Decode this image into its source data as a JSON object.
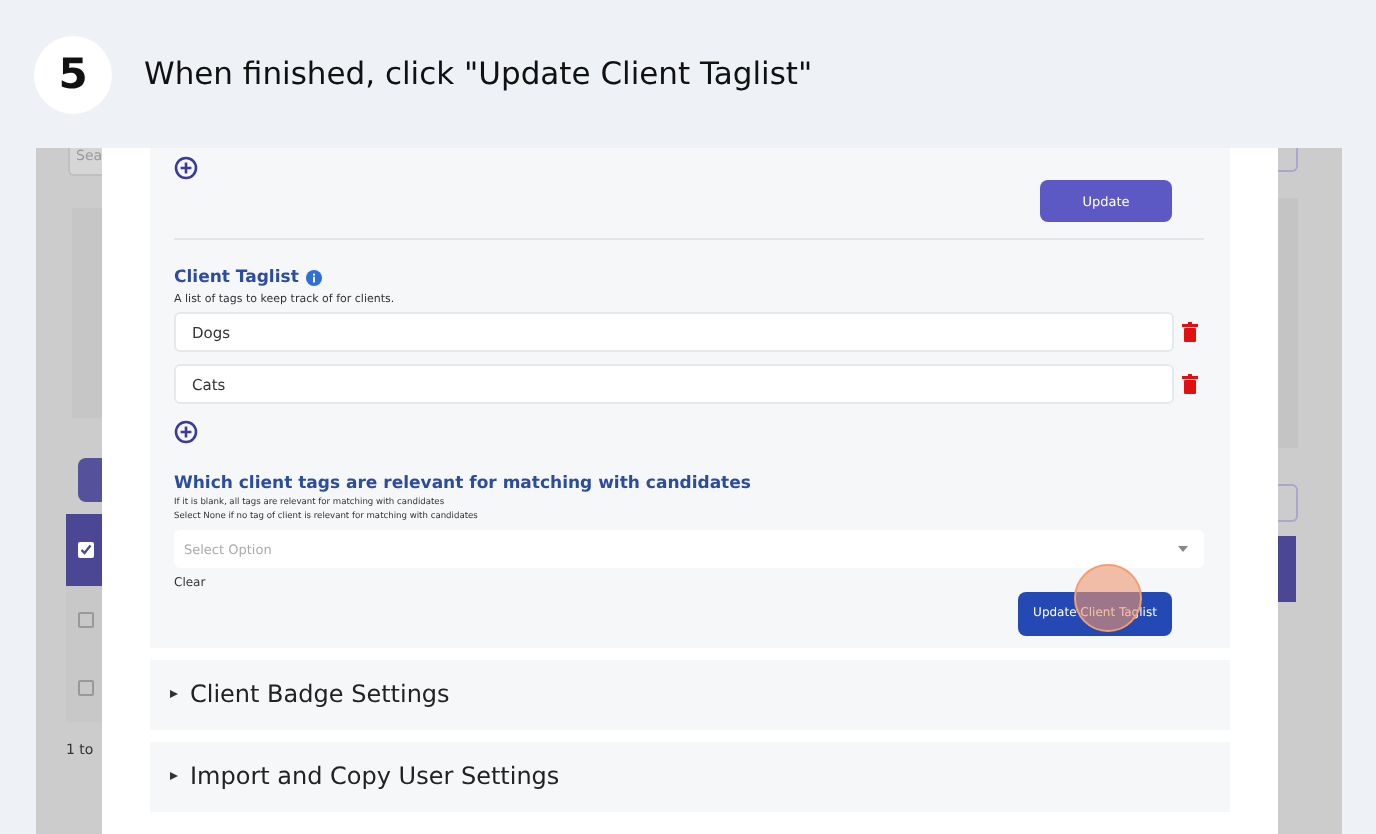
{
  "step": {
    "number": "5",
    "instruction": "When finished, click \"Update Client Taglist\""
  },
  "backdrop": {
    "search_placeholder": "Sea",
    "pagination": "1 to",
    "rows": [
      {
        "checked": true
      },
      {
        "checked": false
      },
      {
        "checked": false
      }
    ]
  },
  "settings": {
    "update_button": "Update",
    "taglist": {
      "title": "Client Taglist",
      "description": "A list of tags to keep track of for clients.",
      "tags": [
        "Dogs",
        "Cats"
      ]
    },
    "matching": {
      "title": "Which client tags are relevant for matching with candidates",
      "hints": [
        "If it is blank, all tags are relevant for matching with candidates",
        "Select None if no tag of client is relevant for matching with candidates"
      ],
      "placeholder": "Select Option",
      "clear": "Clear",
      "submit": "Update Client Taglist"
    },
    "sections": [
      {
        "title": "Client Badge Settings",
        "expanded": false
      },
      {
        "title": "Import and Copy User Settings",
        "expanded": false
      }
    ]
  }
}
